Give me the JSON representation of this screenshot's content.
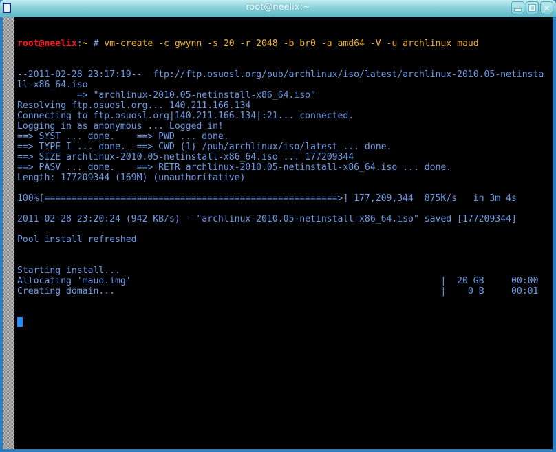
{
  "window": {
    "title": "root@neelix:~",
    "buttons": {
      "minimize": "minimize",
      "maximize": "maximize",
      "close": "close"
    }
  },
  "colors": {
    "text": "#6b9be6",
    "prompt_user": "#ff1a1a",
    "prompt_dir": "#ffe020",
    "command": "#f0b020",
    "cursor": "#1e8cff",
    "background": "#000000",
    "titlebar": "#8fd3dc"
  },
  "prompt": {
    "user_host": "root@neelix",
    "colon": ":",
    "dir": "~",
    "hash": " # ",
    "command": "vm-create -c gwynn -s 20 -r 2048 -b br0 -a amd64 -V -u archlinux maud"
  },
  "output": [
    "--2011-02-28 23:17:19--  ftp://ftp.osuosl.org/pub/archlinux/iso/latest/archlinux-2010.05-netinsta",
    "ll-x86_64.iso",
    "           => \"archlinux-2010.05-netinstall-x86_64.iso\"",
    "Resolving ftp.osuosl.org... 140.211.166.134",
    "Connecting to ftp.osuosl.org|140.211.166.134|:21... connected.",
    "Logging in as anonymous ... Logged in!",
    "==> SYST ... done.    ==> PWD ... done.",
    "==> TYPE I ... done.  ==> CWD (1) /pub/archlinux/iso/latest ... done.",
    "==> SIZE archlinux-2010.05-netinstall-x86_64.iso ... 177209344",
    "==> PASV ... done.    ==> RETR archlinux-2010.05-netinstall-x86_64.iso ... done.",
    "Length: 177209344 (169M) (unauthoritative)",
    "",
    "100%[======================================================>] 177,209,344  875K/s   in 3m 4s",
    "",
    "2011-02-28 23:20:24 (942 KB/s) - \"archlinux-2010.05-netinstall-x86_64.iso\" saved [177209344]",
    "",
    "Pool install refreshed",
    "",
    "",
    "Starting install...",
    "Allocating 'maud.img'                                                         |  20 GB     00:00",
    "Creating domain...                                                            |    0 B     00:01"
  ],
  "download": {
    "progress_percent": 100,
    "bytes": "177,209,344",
    "rate": "875K/s",
    "elapsed": "3m 4s"
  }
}
